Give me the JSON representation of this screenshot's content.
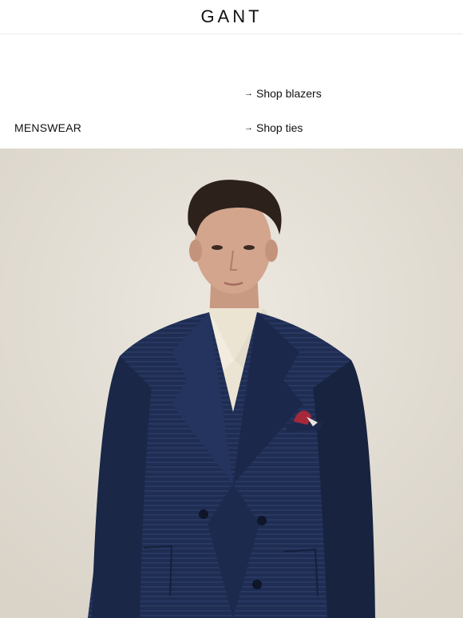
{
  "header": {
    "logo": "GANT"
  },
  "nav": {
    "section_label": "MENSWEAR",
    "links": [
      {
        "label": "Shop blazers",
        "icon": "arrow-right-icon"
      },
      {
        "label": "Shop ties",
        "icon": "arrow-right-icon"
      }
    ]
  },
  "hero": {
    "background_color": "#e6e1d8",
    "jacket_color": "#1f2d52",
    "shirt_color": "#ece4d3",
    "pocket_square_color": "#a7283a"
  }
}
